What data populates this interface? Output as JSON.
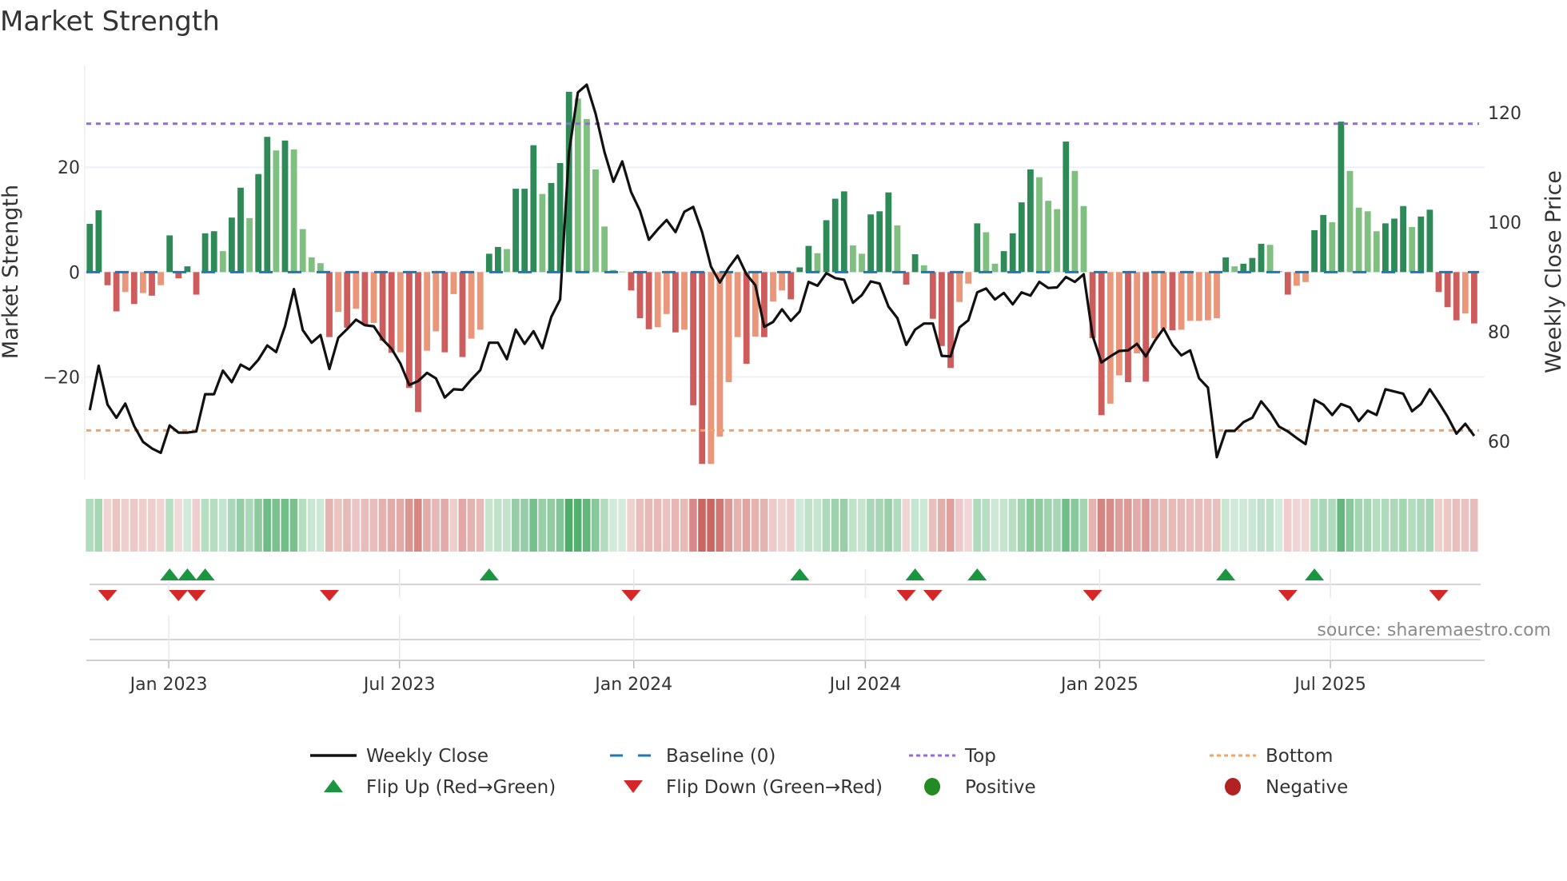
{
  "title": "Market Strength",
  "source": "source: sharemaestro.com",
  "colors": {
    "pos_strong": "#2e8b57",
    "pos_weak": "#7fbf7f",
    "neg_strong": "#cd5c5c",
    "neg_weak": "#e9967a",
    "top": "#9966dd",
    "bottom": "#f4a460",
    "baseline": "#1f77b4",
    "price": "#111111",
    "flip_up": "#1a9641",
    "flip_down": "#d62728",
    "positive": "#228b22",
    "negative": "#b22222"
  },
  "chart_data": {
    "type": "bar",
    "title": "Market Strength",
    "ylabel": "Market Strength",
    "y2label": "Weekly Close Price",
    "ylim": [
      -39.6,
      39.4
    ],
    "y2lim": [
      53,
      128.6
    ],
    "yticks": [
      {
        "label": "20",
        "value": 20
      },
      {
        "label": "0",
        "value": 0
      },
      {
        "label": "−20",
        "value": -20
      }
    ],
    "y2ticks": [
      {
        "label": "120",
        "value": 120
      },
      {
        "label": "100",
        "value": 100
      },
      {
        "label": "80",
        "value": 80
      },
      {
        "label": "60",
        "value": 60
      }
    ],
    "x_ticks": [
      {
        "label": "Jan 2023",
        "week": 8.9
      },
      {
        "label": "Jul 2023",
        "week": 34.9
      },
      {
        "label": "Jan 2024",
        "week": 61.3
      },
      {
        "label": "Jul 2024",
        "week": 87.4
      },
      {
        "label": "Jan 2025",
        "week": 113.8
      },
      {
        "label": "Jul 2025",
        "week": 139.8
      }
    ],
    "top_level": 28.3,
    "bottom_level": -30.2,
    "baseline": 0,
    "strength": [
      9.2,
      11.8,
      -2.5,
      -7.5,
      -3.8,
      -6.1,
      -4.0,
      -4.5,
      -2.5,
      7.0,
      -1.2,
      1.1,
      -4.3,
      7.4,
      7.8,
      4.0,
      10.4,
      16.1,
      10.3,
      18.7,
      25.8,
      23.2,
      25.1,
      23.4,
      8.2,
      2.8,
      1.7,
      -12.4,
      -7.6,
      -10.6,
      -7.0,
      -10.0,
      -9.7,
      -13.1,
      -15.4,
      -15.3,
      -22.1,
      -26.7,
      -15.0,
      -11.3,
      -15.3,
      -4.2,
      -16.2,
      -12.7,
      -11.0,
      3.5,
      4.8,
      4.4,
      15.9,
      15.9,
      24.2,
      14.9,
      17.0,
      20.8,
      34.4,
      33.1,
      29.2,
      19.6,
      8.7,
      0.4,
      0.1,
      -3.5,
      -8.8,
      -10.9,
      -10.5,
      -8.0,
      -11.5,
      -11.0,
      -25.4,
      -36.6,
      -36.6,
      -31.4,
      -21.0,
      -12.4,
      -17.5,
      -12.3,
      -12.4,
      -5.6,
      -3.5,
      -5.2,
      0.9,
      5.0,
      3.6,
      9.9,
      14.0,
      15.4,
      5.1,
      3.5,
      11.0,
      11.6,
      15.2,
      8.9,
      -2.4,
      3.4,
      1.3,
      -8.9,
      -14.1,
      -18.3,
      -5.7,
      -2.2,
      9.3,
      7.6,
      1.6,
      4.0,
      7.4,
      13.3,
      19.6,
      18.1,
      13.6,
      12.0,
      24.9,
      19.3,
      12.6,
      -12.6,
      -27.3,
      -25.1,
      -19.7,
      -21.0,
      -15.5,
      -20.9,
      -12.6,
      -10.8,
      -11.1,
      -11.0,
      -9.3,
      -9.3,
      -9.2,
      -8.8,
      2.8,
      1.1,
      1.6,
      2.7,
      5.4,
      5.2,
      0.2,
      -4.3,
      -2.6,
      -1.9,
      8.0,
      10.9,
      9.5,
      28.7,
      19.3,
      12.3,
      11.6,
      7.8,
      9.3,
      10.2,
      12.6,
      8.6,
      10.6,
      11.9,
      -3.8,
      -6.7,
      -9.2,
      -7.9,
      -9.8
    ],
    "weekly_close": [
      65.7,
      73.8,
      66.7,
      64.3,
      66.9,
      62.8,
      59.9,
      58.7,
      57.9,
      62.9,
      61.6,
      61.6,
      61.8,
      68.6,
      68.6,
      72.9,
      70.8,
      74.0,
      73.1,
      74.9,
      77.5,
      76.3,
      81.0,
      87.8,
      80.3,
      78.0,
      79.4,
      73.2,
      78.9,
      80.5,
      82.2,
      81.2,
      81.0,
      78.6,
      76.9,
      74.2,
      70.3,
      71.0,
      72.5,
      71.5,
      68.0,
      69.5,
      69.4,
      71.3,
      73.0,
      78.0,
      78.0,
      75.0,
      80.4,
      77.8,
      80.1,
      77.0,
      82.7,
      85.9,
      112.8,
      123.7,
      125.1,
      119.8,
      112.8,
      107.4,
      111.1,
      105.5,
      102.1,
      96.8,
      98.7,
      100.4,
      98.2,
      101.9,
      102.8,
      98.2,
      91.9,
      89.0,
      91.7,
      93.9,
      90.5,
      88.5,
      80.9,
      81.8,
      84.1,
      82.0,
      83.7,
      89.1,
      88.4,
      90.7,
      89.8,
      89.5,
      85.3,
      86.7,
      89.2,
      88.8,
      84.6,
      82.5,
      77.6,
      80.4,
      81.5,
      81.5,
      75.6,
      75.5,
      80.8,
      82.1,
      87.2,
      87.9,
      85.9,
      87.1,
      85.0,
      87.2,
      86.6,
      89.1,
      88.0,
      88.1,
      90.0,
      89.1,
      90.5,
      79.3,
      74.4,
      75.5,
      76.5,
      76.6,
      77.8,
      75.5,
      78.3,
      80.6,
      77.6,
      75.7,
      76.6,
      71.5,
      69.8,
      57.1,
      61.9,
      61.9,
      63.5,
      64.3,
      67.3,
      65.3,
      62.7,
      61.8,
      60.6,
      59.5,
      67.6,
      66.7,
      64.8,
      66.8,
      66.2,
      63.7,
      65.6,
      64.8,
      69.5,
      69.1,
      68.7,
      65.5,
      66.8,
      69.5,
      67.1,
      64.5,
      61.4,
      63.2,
      61.0
    ],
    "flip_up_weeks": [
      9,
      11,
      13,
      45,
      80,
      93,
      100,
      128,
      138
    ],
    "flip_down_weeks": [
      2,
      10,
      12,
      27,
      61,
      92,
      95,
      113,
      135,
      152
    ],
    "legend_position": "bottom",
    "legend": [
      {
        "label": "Weekly Close",
        "kind": "line"
      },
      {
        "label": "Baseline (0)",
        "kind": "dash"
      },
      {
        "label": "Top",
        "kind": "dot-top"
      },
      {
        "label": "Bottom",
        "kind": "dot-bottom"
      },
      {
        "label": "Flip Up (Red→Green)",
        "kind": "tri-up"
      },
      {
        "label": "Flip Down (Green→Red)",
        "kind": "tri-down"
      },
      {
        "label": "Positive",
        "kind": "dot-pos"
      },
      {
        "label": "Negative",
        "kind": "dot-neg"
      }
    ]
  }
}
